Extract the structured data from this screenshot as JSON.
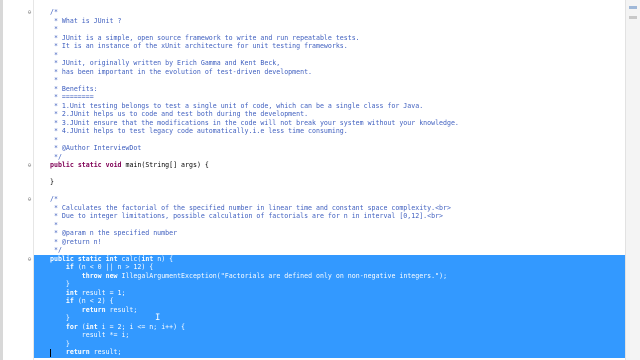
{
  "editor": {
    "lines": [
      {
        "t": "/*",
        "c": "comment"
      },
      {
        "t": " * What is JUnit ?",
        "c": "comment"
      },
      {
        "t": " *",
        "c": "comment"
      },
      {
        "t": " * JUnit is a simple, open source framework to write and run repeatable tests.",
        "c": "comment"
      },
      {
        "t": " * It is an instance of the xUnit architecture for unit testing frameworks.",
        "c": "comment"
      },
      {
        "t": " *",
        "c": "comment"
      },
      {
        "t": " * JUnit, originally written by Erich Gamma and Kent Beck,",
        "c": "comment"
      },
      {
        "t": " * has been important in the evolution of test-driven development.",
        "c": "comment"
      },
      {
        "t": " *",
        "c": "comment"
      },
      {
        "t": " * Benefits:",
        "c": "comment"
      },
      {
        "t": " * ========",
        "c": "comment"
      },
      {
        "t": " * 1.Unit testing belongs to test a single unit of code, which can be a single class for Java.",
        "c": "comment"
      },
      {
        "t": " * 2.JUnit helps us to code and test both during the development.",
        "c": "comment"
      },
      {
        "t": " * 3.JUnit ensure that the modifications in the code will not break your system without your knowledge.",
        "c": "comment"
      },
      {
        "t": " * 4.JUnit helps to test legacy code automatically.i.e less time consuming.",
        "c": "comment"
      },
      {
        "t": " *",
        "c": "comment"
      },
      {
        "t": " * @Author InterviewDot",
        "c": "comment"
      },
      {
        "t": " */",
        "c": "comment"
      },
      {
        "t": "public static void main(String[] args) {",
        "c": "code"
      },
      {
        "t": "",
        "c": "code"
      },
      {
        "t": "}",
        "c": "code"
      },
      {
        "t": "",
        "c": "code"
      },
      {
        "t": "/*",
        "c": "comment"
      },
      {
        "t": " * Calculates the factorial of the specified number in linear time and constant space complexity.<br>",
        "c": "comment"
      },
      {
        "t": " * Due to integer limitations, possible calculation of factorials are for n in interval [0,12].<br>",
        "c": "comment"
      },
      {
        "t": " *",
        "c": "comment"
      },
      {
        "t": " * @param n the specified number",
        "c": "comment"
      },
      {
        "t": " * @return n!",
        "c": "comment"
      },
      {
        "t": " */",
        "c": "comment"
      },
      {
        "t": "public static int calc(int n) {",
        "c": "sel"
      },
      {
        "t": "    if (n < 0 || n > 12) {",
        "c": "sel"
      },
      {
        "t": "        throw new IllegalArgumentException(\"Factorials are defined only on non-negative integers.\");",
        "c": "sel"
      },
      {
        "t": "    }",
        "c": "sel"
      },
      {
        "t": "    int result = 1;",
        "c": "sel"
      },
      {
        "t": "    if (n < 2) {",
        "c": "sel"
      },
      {
        "t": "        return result;",
        "c": "sel"
      },
      {
        "t": "    }",
        "c": "sel"
      },
      {
        "t": "    for (int i = 2; i <= n; i++) {",
        "c": "sel"
      },
      {
        "t": "        result *= i;",
        "c": "sel"
      },
      {
        "t": "    }",
        "c": "sel"
      },
      {
        "t": "    return result;",
        "c": "sel"
      }
    ]
  },
  "colors": {
    "selection": "#3399ff",
    "comment": "#3f5fbf",
    "keyword": "#7f0055",
    "string": "#2a00ff"
  },
  "icons": [
    "fold-collapse-icon",
    "text-cursor-icon"
  ]
}
